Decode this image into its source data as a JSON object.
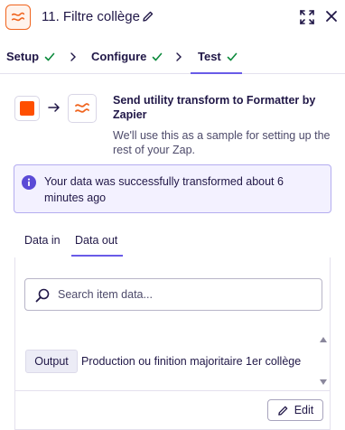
{
  "header": {
    "step_title": "11. Filtre collège"
  },
  "steps": [
    {
      "label": "Setup"
    },
    {
      "label": "Configure"
    },
    {
      "label": "Test"
    }
  ],
  "summary": {
    "title": "Send utility transform to Formatter by Zapier",
    "subtitle": "We'll use this as a sample for setting up the rest of your Zap."
  },
  "alert": {
    "text": "Your data was successfully transformed about 6 minutes ago"
  },
  "data_tabs": {
    "in_label": "Data in",
    "out_label": "Data out",
    "active": "Data out"
  },
  "search": {
    "placeholder": "Search item data..."
  },
  "output": {
    "key": "Output",
    "value": "Production ou finition majoritaire 1er collège"
  },
  "edit_button": {
    "label": "Edit"
  },
  "colors": {
    "accent": "#695be8",
    "zapier_orange": "#ff4f00",
    "check_green": "#0c8a3c"
  }
}
